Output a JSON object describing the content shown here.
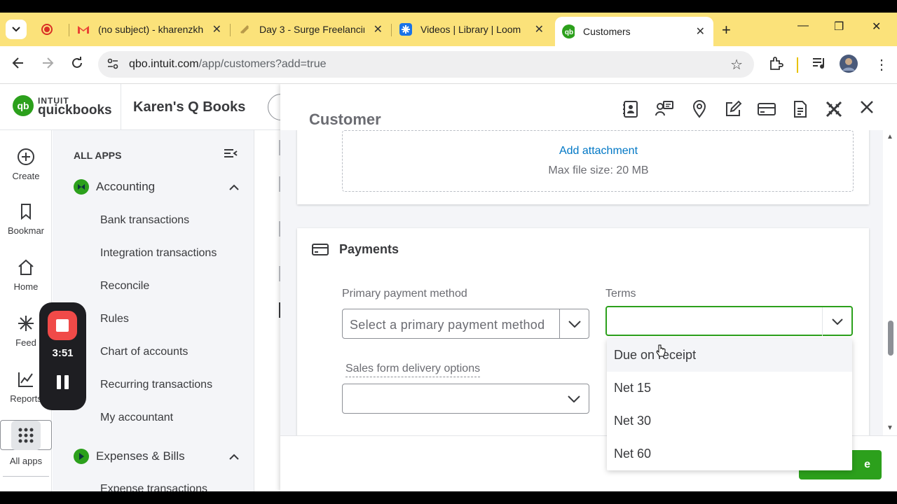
{
  "browser": {
    "tabs": [
      {
        "label": "",
        "icon": "record-icon"
      },
      {
        "label": "(no subject) - kharenzkh",
        "icon": "gmail-icon"
      },
      {
        "label": "Day 3 - Surge Freelancin",
        "icon": "surge-icon"
      },
      {
        "label": "Videos | Library | Loom",
        "icon": "loom-icon"
      },
      {
        "label": "Customers",
        "icon": "quickbooks-icon",
        "active": true
      }
    ],
    "url_host": "qbo.intuit.com",
    "url_path": "/app/customers?add=true"
  },
  "brand": {
    "intuit": "INTUIT",
    "quickbooks": "quickbooks",
    "company": "Karen's Q Books"
  },
  "rail": [
    {
      "label": "Create",
      "icon": "plus-circle-icon"
    },
    {
      "label": "Bookmar",
      "icon": "bookmark-icon"
    },
    {
      "label": "Home",
      "icon": "home-icon"
    },
    {
      "label": "Feed",
      "icon": "feed-icon"
    },
    {
      "label": "Reports",
      "icon": "reports-icon"
    },
    {
      "label": "All apps",
      "icon": "apps-grid-icon",
      "selected": true
    }
  ],
  "menu": {
    "header": "ALL APPS",
    "sections": [
      {
        "label": "Accounting",
        "color": "#2ca01c"
      },
      {
        "label": "Expenses & Bills",
        "color": "#2ca01c"
      }
    ],
    "accounting_items": [
      "Bank transactions",
      "Integration transactions",
      "Reconcile",
      "Rules",
      "Chart of accounts",
      "Recurring transactions",
      "My accountant"
    ],
    "expense_items": [
      "Expense transactions"
    ]
  },
  "recorder": {
    "time": "3:51"
  },
  "drawer": {
    "title": "Customer",
    "attachment": {
      "link": "Add attachment",
      "max_size": "Max file size: 20 MB"
    },
    "payments": {
      "title": "Payments",
      "primary_label": "Primary payment method",
      "primary_placeholder": "Select a primary payment method",
      "terms_label": "Terms",
      "terms_value": "",
      "delivery_label": "Sales form delivery options",
      "delivery_value": ""
    },
    "terms_options": [
      "Due on receipt",
      "Net 15",
      "Net 30",
      "Net 60"
    ],
    "save_label": "e"
  },
  "colors": {
    "accent": "#2ca01c",
    "link": "#0077c5",
    "tabstrip": "#fbe27a"
  }
}
